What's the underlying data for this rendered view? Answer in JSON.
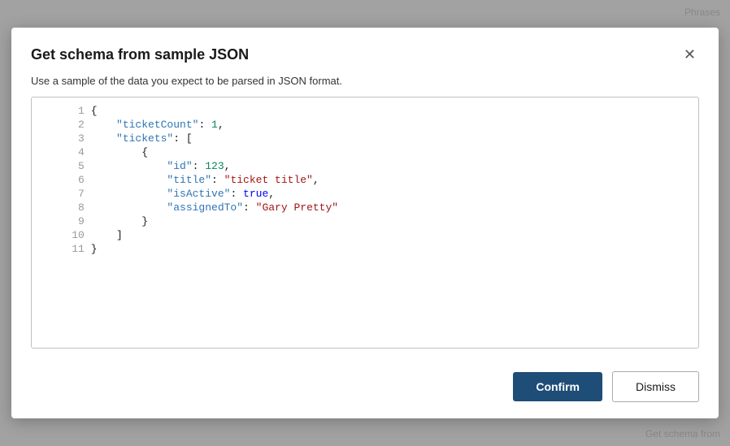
{
  "dialog": {
    "title": "Get schema from sample JSON",
    "subtitle": "Use a sample of the data you expect to be parsed in JSON format.",
    "confirm_label": "Confirm",
    "dismiss_label": "Dismiss"
  },
  "code": {
    "lines": [
      {
        "num": 1,
        "content": "{"
      },
      {
        "num": 2,
        "content": "    \"ticketCount\": 1,"
      },
      {
        "num": 3,
        "content": "    \"tickets\": ["
      },
      {
        "num": 4,
        "content": "        {"
      },
      {
        "num": 5,
        "content": "            \"id\": 123,"
      },
      {
        "num": 6,
        "content": "            \"title\": \"ticket title\","
      },
      {
        "num": 7,
        "content": "            \"isActive\": true,"
      },
      {
        "num": 8,
        "content": "            \"assignedTo\": \"Gary Pretty\""
      },
      {
        "num": 9,
        "content": "        }"
      },
      {
        "num": 10,
        "content": "    ]"
      },
      {
        "num": 11,
        "content": "}"
      }
    ]
  },
  "background": {
    "top_hint": "Phrases",
    "bottom_hint": "Get schema from"
  },
  "icons": {
    "close": "✕"
  }
}
